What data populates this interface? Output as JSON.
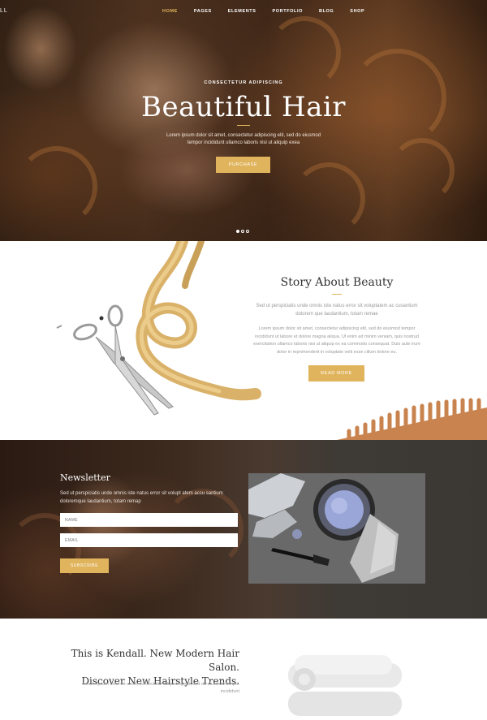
{
  "header": {
    "logo_fragment": "LL",
    "nav": [
      "HOME",
      "PAGES",
      "ELEMENTS",
      "PORTFOLIO",
      "BLOG",
      "SHOP"
    ],
    "active_nav": "HOME"
  },
  "hero": {
    "kicker": "CONSECTETUR ADIPISCING",
    "title": "Beautiful Hair",
    "text": "Lorem ipsum dolor sit amet, consectetur adipiscing elit, sed do eiusmod tempor incididunt ullamco laboris nisi ut aliquip exea",
    "button": "PURCHASE",
    "slides": 3,
    "active_slide": 1
  },
  "story": {
    "title": "Story About Beauty",
    "lead": "Sed ut perspiciatis unde omnis iste natus error sit voluptatem ac cusantium dolorem que laudantium, totam remae",
    "body": "Lorem ipsum dolor sit amet, consectetur adipiscing elit, sed do eiusmod tempor incididunt ut labore et dolore magna aliqua. Ut enim ad minim veniam, quis nostrud exercitation ullamco laboris nisi ut aliquip ex ea commodo consequat. Duis aute irure dolor in reprehenderit in voluptate velit esse cillum dolore eu.",
    "button": "READ MORE"
  },
  "newsletter": {
    "title": "Newsletter",
    "text": "Sed ut perspiciatis unde omnis iste natus error sit volupt atem accu santium doloremque laudantium, totam remap",
    "name_placeholder": "NAME",
    "email_placeholder": "EMAIL",
    "button": "SUBSCRIBE"
  },
  "intro": {
    "title_line1": "This is Kendall. New Modern Hair Salon.",
    "title_line2": "Discover New Hairstyle Trends.",
    "text": "Lorem ipsum dolor sit amet, consectetur adipiscing elit, sed do eiusmod tempor incididunt"
  },
  "colors": {
    "accent": "#e0b45c",
    "dark_band": "#3d3935",
    "heading": "#333333",
    "muted_text": "#999999"
  },
  "icons": [
    "scissors-image",
    "hair-knot-image",
    "comb-image",
    "hair-dye-bowl-image",
    "towel-image"
  ]
}
